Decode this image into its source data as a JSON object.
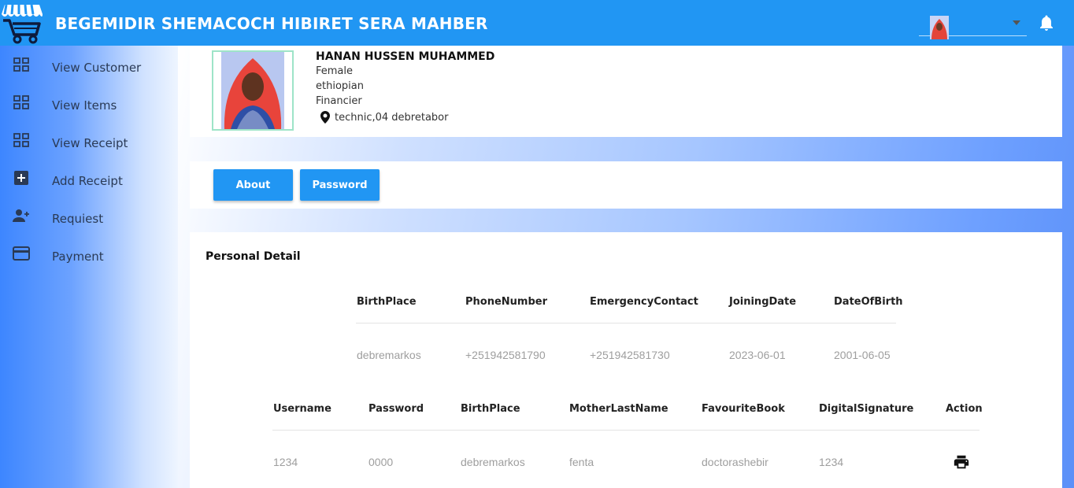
{
  "app": {
    "title": "BEGEMIDIR SHEMACOCH HIBIRET SERA MAHBER"
  },
  "icons": {
    "logo": "shopping-cart-icon",
    "notifications": "bell-icon",
    "location": "map-pin-icon",
    "print": "printer-icon"
  },
  "colors": {
    "header": "#2196f3",
    "button": "#2196f3",
    "sidebar_text": "#2a3a55",
    "muted_value": "#9e9e9e"
  },
  "sidebar": {
    "items": [
      {
        "label": "View Customer",
        "icon": "grid-icon"
      },
      {
        "label": "View Items",
        "icon": "grid-icon"
      },
      {
        "label": "View Receipt",
        "icon": "grid-icon"
      },
      {
        "label": "Add Receipt",
        "icon": "add-box-icon"
      },
      {
        "label": "Requiest",
        "icon": "person-add-icon"
      },
      {
        "label": "Payment",
        "icon": "credit-card-icon"
      }
    ]
  },
  "profile": {
    "name": "HANAN HUSSEN MUHAMMED",
    "gender": "Female",
    "nationality": "ethiopian",
    "role": "Financier",
    "address": "technic,04 debretabor"
  },
  "tabs": {
    "about": "About",
    "password": "Password"
  },
  "personal_detail": {
    "title": "Personal Detail",
    "table1": {
      "headers": [
        "BirthPlace",
        "PhoneNumber",
        "EmergencyContact",
        "JoiningDate",
        "DateOfBirth"
      ],
      "row": [
        "debremarkos",
        "+251942581790",
        "+251942581730",
        "2023-06-01",
        "2001-06-05"
      ]
    },
    "table2": {
      "headers": [
        "Username",
        "Password",
        "BirthPlace",
        "MotherLastName",
        "FavouriteBook",
        "DigitalSignature",
        "Action"
      ],
      "row": [
        "1234",
        "0000",
        "debremarkos",
        "fenta",
        "doctorashebir",
        "1234"
      ]
    }
  }
}
